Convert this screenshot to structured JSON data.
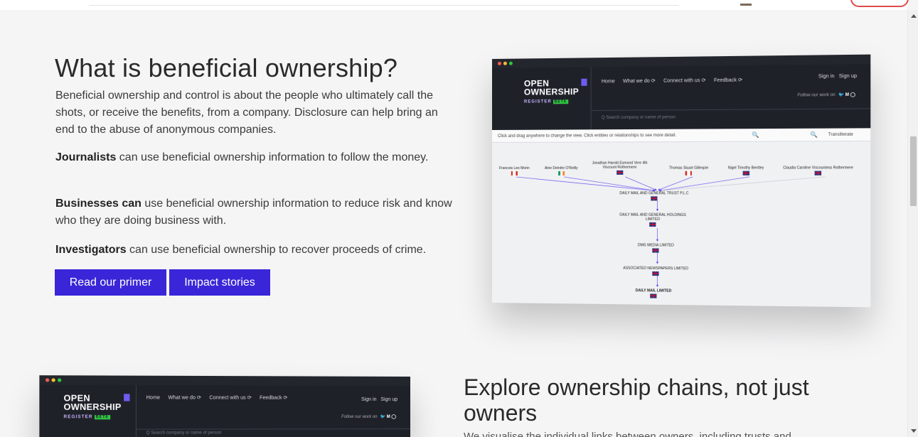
{
  "section1": {
    "title": "What is beneficial ownership?",
    "intro": "Beneficial ownership and control is about the people who ultimately call the shots, or receive the benefits, from a company. Disclosure can help bring an end to the abuse of anonymous companies.",
    "points": [
      {
        "bold": "Journalists",
        "text": " can use beneficial ownership information to follow the money."
      },
      {
        "bold": "Businesses can",
        "text": " use beneficial ownership information to reduce risk and know who they are doing business with."
      },
      {
        "bold": "Investigators",
        "text": " can use beneficial ownership to recover proceeds of crime."
      }
    ],
    "buttons": {
      "primer": "Read our primer",
      "impact": "Impact stories"
    }
  },
  "section2": {
    "title": "Explore ownership chains, not just owners",
    "text": "We visualise the individual links between owners, including trusts and"
  },
  "mockup": {
    "logo_line1": "OPEN",
    "logo_line2": "OWNERSHIP",
    "logo_register": "REGISTER",
    "logo_beta": "BETA",
    "nav": [
      "Home",
      "What we do ⟳",
      "Connect with us ⟳",
      "Feedback ⟳"
    ],
    "signin": "Sign in",
    "signup": "Sign up",
    "follow": "Follow our work on",
    "follow_icons": "🐦 M ◯",
    "search_placeholder": "Q  Search company or name of person",
    "toolbar_hint": "Click and drag anywhere to change the view. Click entities or relationships to see more detail.",
    "zoom_icon": "🔍",
    "transliterate": "Transliterate",
    "owners": [
      {
        "name": "Francois Leo Morin",
        "flag": "ca"
      },
      {
        "name": "Aine Deirdre O'Reilly",
        "flag": "ie"
      },
      {
        "name": "Jonathan Harold Esmond Vere 4th\nViscount Rothermere",
        "flag": "uk"
      },
      {
        "name": "Thomas Stuart Gillespie",
        "flag": "ca"
      },
      {
        "name": "Nigel Timothy Bentley",
        "flag": "uk"
      },
      {
        "name": "Claudia Caroline Viscountess Rothermere",
        "flag": "uk"
      }
    ],
    "chain": [
      "DAILY MAIL AND GENERAL TRUST P.L.C",
      "DAILY MAIL AND GENERAL HOLDINGS\nLIMITED",
      "DMG MEDIA LIMITED",
      "ASSOCIATED NEWSPAPERS LIMITED",
      "DAILY MAIL LIMITED"
    ]
  },
  "colors": {
    "accent": "#3a26d8",
    "navbar": "#1f2129"
  }
}
